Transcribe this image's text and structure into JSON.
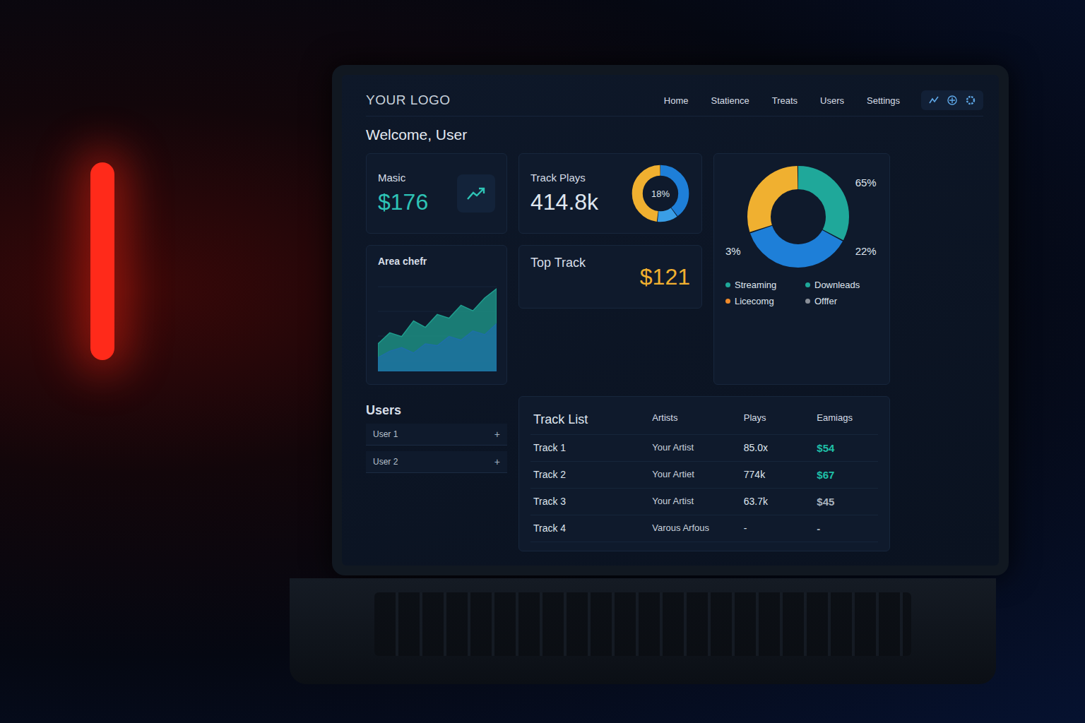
{
  "nav": {
    "logo": "YOUR LOGO",
    "links": [
      "Home",
      "Statience",
      "Treats",
      "Users",
      "Settings"
    ]
  },
  "welcome": "Welcome, User",
  "stat_card": {
    "label": "Masic",
    "value": "$176"
  },
  "plays_card": {
    "label": "Track Plays",
    "value": "414.8k",
    "donut_label": "18%",
    "donut": [
      {
        "value": 40,
        "color": "#1e7fd8"
      },
      {
        "value": 12,
        "color": "#3a9ee6"
      },
      {
        "value": 48,
        "color": "#f0b030"
      }
    ]
  },
  "top_track": {
    "label": "Top Track",
    "value": "$121"
  },
  "area_chart": {
    "title": "Area chefr",
    "series": [
      {
        "values": [
          30,
          42,
          38,
          55,
          48,
          62,
          58,
          72,
          66,
          80,
          90
        ],
        "color": "#1f9e8e"
      },
      {
        "values": [
          15,
          22,
          26,
          20,
          30,
          28,
          38,
          34,
          44,
          40,
          52
        ],
        "color": "#1e6fa8"
      }
    ]
  },
  "breakdown": {
    "donut": [
      {
        "value": 33,
        "color": "#1fa89a"
      },
      {
        "value": 37,
        "color": "#1e7fd8"
      },
      {
        "value": 30,
        "color": "#f0b030"
      }
    ],
    "labels": [
      "65%",
      "22%",
      "3%"
    ],
    "legend": [
      {
        "label": "Streaming",
        "color": "#1fa89a"
      },
      {
        "label": "Downleads",
        "color": "#1fa89a"
      },
      {
        "label": "Licecomg",
        "color": "#f08a2a"
      },
      {
        "label": "Offfer",
        "color": "#8a8f98"
      }
    ]
  },
  "users": {
    "title": "Users",
    "items": [
      {
        "label": "User 1",
        "action": "+"
      },
      {
        "label": "User 2",
        "action": "+"
      }
    ]
  },
  "track_list": {
    "title": "Track List",
    "columns": [
      "Artists",
      "Plays",
      "Eamiags"
    ],
    "rows": [
      {
        "cells": [
          "Track 1",
          "Your Artist",
          "85.0x",
          "$54"
        ],
        "color": "#1fc0a8"
      },
      {
        "cells": [
          "Track 2",
          "Your Artiet",
          "774k",
          "$67"
        ],
        "color": "#1fc0a8"
      },
      {
        "cells": [
          "Track 3",
          "Your Artist",
          "63.7k",
          "$45"
        ],
        "color": "#a8b2bd"
      },
      {
        "cells": [
          "Track 4",
          "Varous Arfous",
          "-",
          "-"
        ],
        "color": "#a8b2bd"
      }
    ]
  }
}
